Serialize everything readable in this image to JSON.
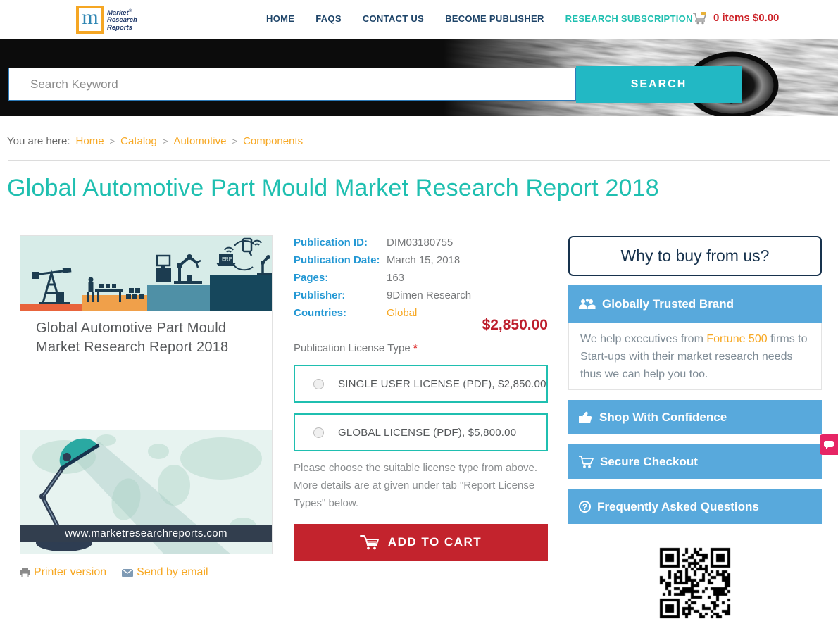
{
  "header": {
    "logo": {
      "monogram": "m",
      "line1": "Market",
      "registered": "®",
      "line2": "Research",
      "line3": "Reports"
    },
    "nav": [
      {
        "label": "HOME"
      },
      {
        "label": "FAQS"
      },
      {
        "label": "CONTACT US"
      },
      {
        "label": "BECOME PUBLISHER"
      },
      {
        "label": "RESEARCH SUBSCRIPTION"
      }
    ],
    "cart_text": "0 items $0.00"
  },
  "search": {
    "placeholder": "Search Keyword",
    "button_label": "SEARCH"
  },
  "breadcrumb": {
    "prefix": "You are here:",
    "separator": ">",
    "items": [
      {
        "label": "Home"
      },
      {
        "label": "Catalog"
      },
      {
        "label": "Automotive"
      },
      {
        "label": "Components"
      }
    ]
  },
  "page_title": "Global Automotive Part Mould Market Research Report 2018",
  "cover": {
    "title_line1": "Global Automotive Part Mould",
    "title_line2": "Market Research Report 2018",
    "erp_label": "ERP",
    "website": "www.marketresearchreports.com"
  },
  "details": {
    "rows": [
      {
        "label": "Publication ID:",
        "value": "DIM03180755"
      },
      {
        "label": "Publication Date:",
        "value": "March 15, 2018"
      },
      {
        "label": "Pages:",
        "value": "163"
      },
      {
        "label": "Publisher:",
        "value": "9Dimen Research"
      },
      {
        "label": "Countries:",
        "value": "Global"
      }
    ],
    "price": "$2,850.00",
    "license_type_label": "Publication License Type",
    "required_mark": "*",
    "licenses": [
      {
        "label": "SINGLE USER LICENSE (PDF), $2,850.00"
      },
      {
        "label": "GLOBAL LICENSE (PDF), $5,800.00"
      }
    ],
    "note": "Please choose the suitable license type from above. More details are at given under tab \"Report License Types\" below.",
    "add_to_cart_label": "ADD TO CART"
  },
  "page_actions": {
    "printer_label": "Printer version",
    "email_label": "Send by email"
  },
  "sidebar": {
    "why_title": "Why to buy from us?",
    "trusted_title": "Globally Trusted Brand",
    "trusted_body_before": "We help executives from ",
    "trusted_link": "Fortune 500",
    "trusted_body_after": " firms to Start-ups with their market research needs thus we can help you too.",
    "bar_confidence": "Shop With Confidence",
    "bar_checkout": "Secure Checkout",
    "bar_faq": "Frequently Asked Questions",
    "faq_icon_glyph": "?"
  },
  "colors": {
    "teal": "#1fbfb0",
    "search_teal": "#22b8c4",
    "navy": "#1f4569",
    "orange_link": "#f7a823",
    "label_blue": "#2498d4",
    "price_red": "#bd1e2c",
    "button_red": "#c3232d",
    "bar_blue": "#58a9dc",
    "chat_pink": "#e62565"
  }
}
